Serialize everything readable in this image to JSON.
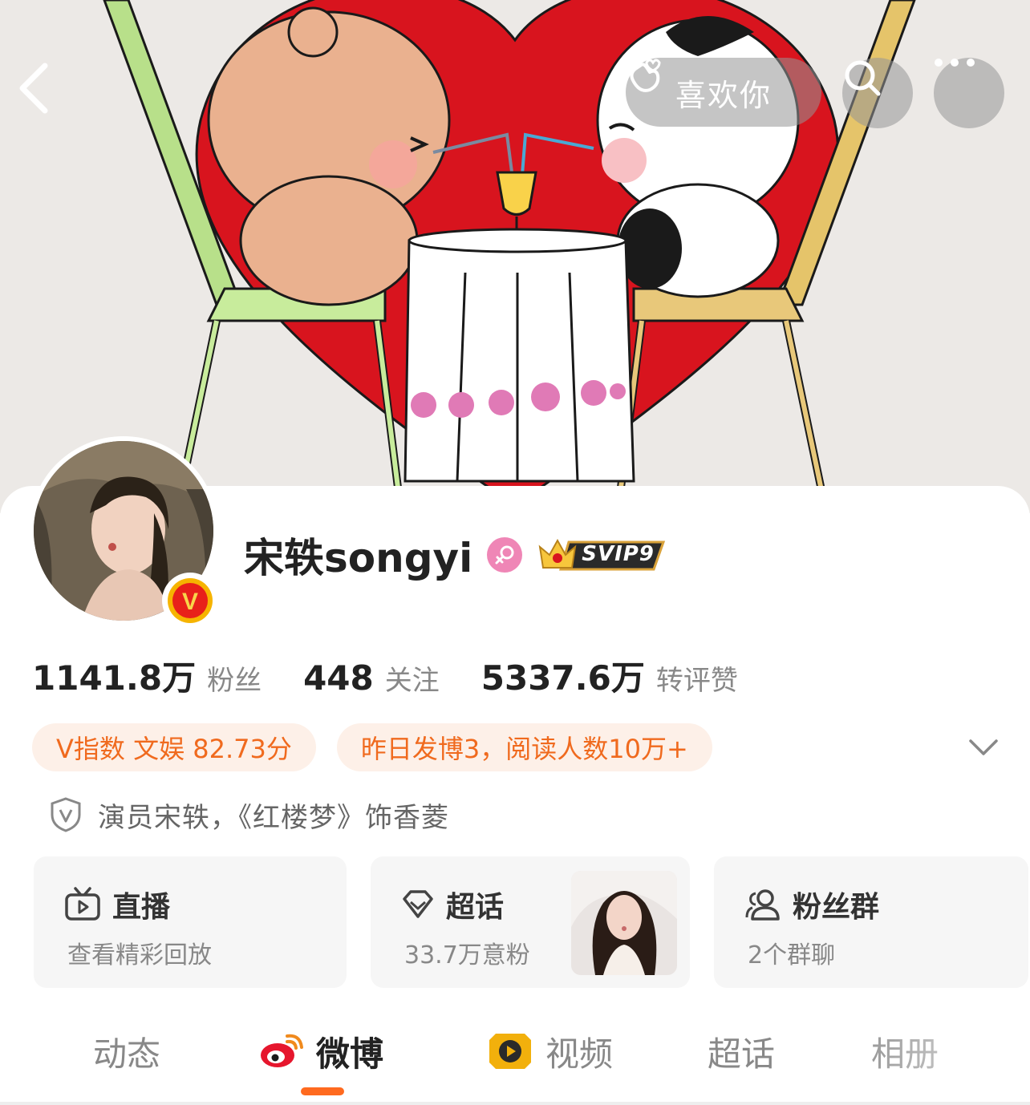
{
  "header": {
    "like_label": "喜欢你",
    "icons": [
      "back-icon",
      "hand-heart-icon",
      "search-icon",
      "more-icon"
    ]
  },
  "profile": {
    "username": "宋轶songyi",
    "gender": "female",
    "vip_badge": "SVIP9",
    "verified": "V",
    "stats": [
      {
        "value": "1141.8万",
        "label": "粉丝"
      },
      {
        "value": "448",
        "label": "关注"
      },
      {
        "value": "5337.6万",
        "label": "转评赞"
      }
    ],
    "tags": [
      "V指数 文娱 82.73分",
      "昨日发博3，阅读人数10万+"
    ],
    "bio": "演员宋轶，《红楼梦》饰香菱"
  },
  "cards": {
    "live": {
      "title": "直播",
      "subtitle": "查看精彩回放"
    },
    "topic": {
      "title": "超话",
      "subtitle": "33.7万意粉"
    },
    "fans": {
      "title": "粉丝群",
      "subtitle": "2个群聊"
    }
  },
  "tabs": {
    "dongtai": "动态",
    "weibo": "微博",
    "video": "视频",
    "chaohua": "超话",
    "album": "相册",
    "active": "weibo"
  },
  "colors": {
    "accent": "#ff6a1f",
    "tag_bg": "#fdf0e8",
    "tag_text": "#f06a1e",
    "heart": "#d8141e"
  }
}
